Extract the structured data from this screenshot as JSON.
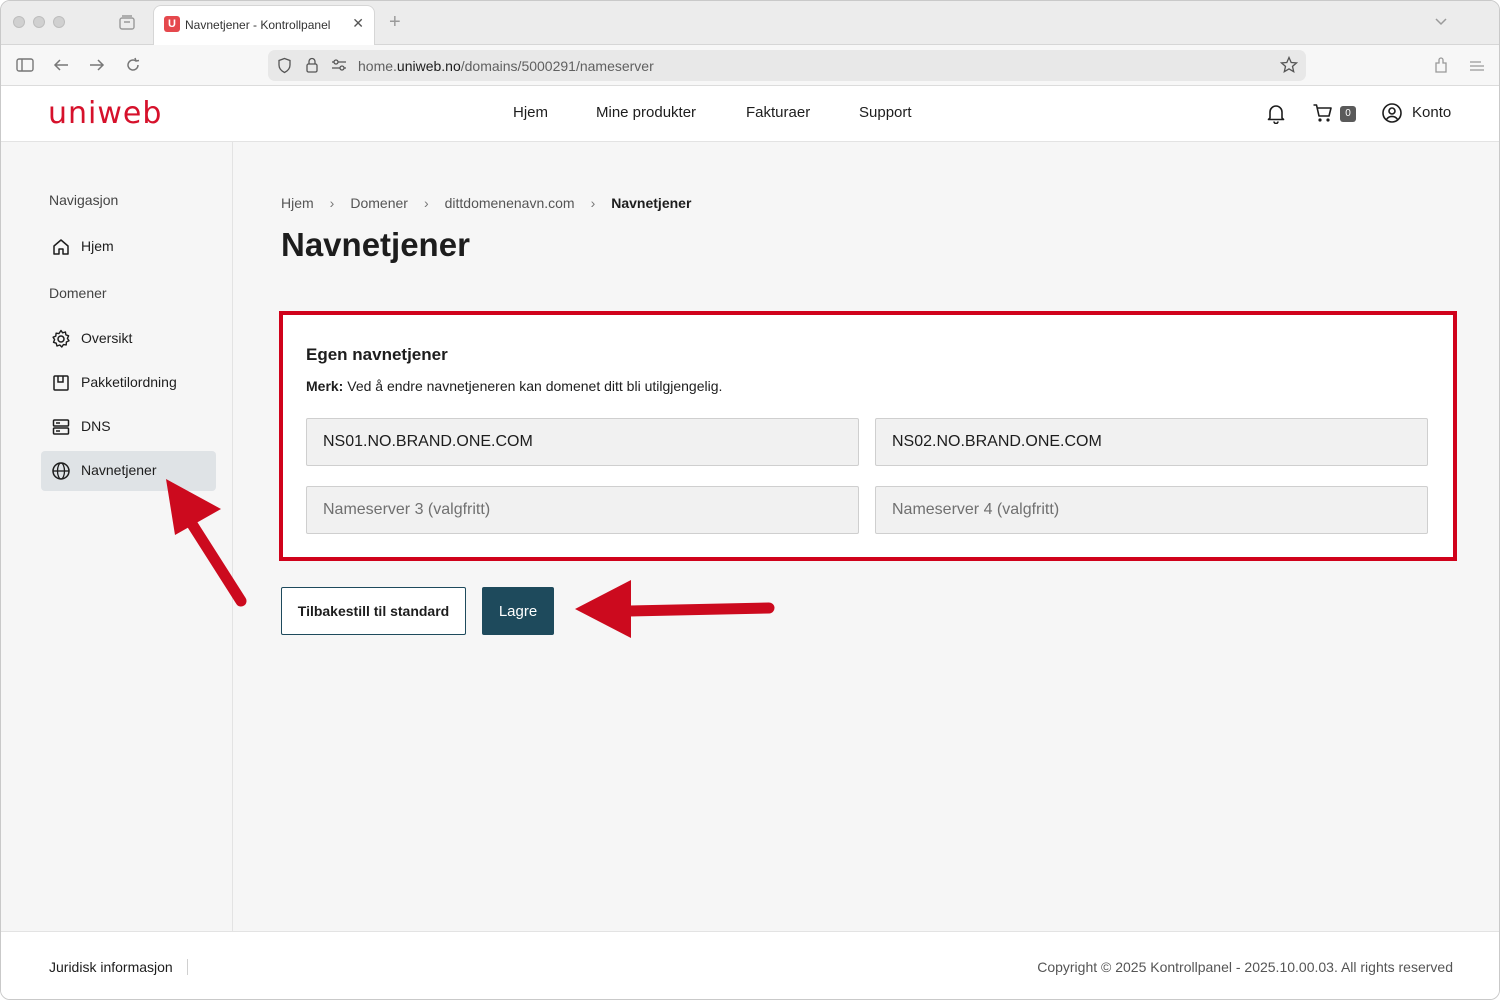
{
  "browser": {
    "tab_title": "Navnetjener - Kontrollpanel",
    "tab_favicon": "U",
    "url_prefix": "home.",
    "url_host": "uniweb.no",
    "url_path": "/domains/5000291/nameserver"
  },
  "header": {
    "logo": "uniweb",
    "nav": [
      "Hjem",
      "Mine produkter",
      "Fakturaer",
      "Support"
    ],
    "cart_count": "0",
    "account": "Konto"
  },
  "sidebar": {
    "heading_nav": "Navigasjon",
    "home": "Hjem",
    "heading_domains": "Domener",
    "items": [
      "Oversikt",
      "Pakketilordning",
      "DNS",
      "Navnetjener"
    ]
  },
  "breadcrumb": [
    "Hjem",
    "Domener",
    "dittdomenenavn.com",
    "Navnetjener"
  ],
  "page_title": "Navnetjener",
  "form": {
    "title": "Egen navnetjener",
    "note_label": "Merk:",
    "note_text": " Ved å endre navnetjeneren kan domenet ditt bli utilgjengelig.",
    "ns1_value": "NS01.NO.BRAND.ONE.COM",
    "ns2_value": "NS02.NO.BRAND.ONE.COM",
    "ns3_placeholder": "Nameserver 3 (valgfritt)",
    "ns4_placeholder": "Nameserver 4 (valgfritt)",
    "reset_label": "Tilbakestill til standard",
    "save_label": "Lagre"
  },
  "footer": {
    "legal": "Juridisk informasjon",
    "copyright": "Copyright © 2025 Kontrollpanel - 2025.10.00.03. All rights reserved"
  },
  "colors": {
    "brand": "#d6112b",
    "primary_button": "#1e4a5c",
    "highlight_border": "#d0021b"
  }
}
